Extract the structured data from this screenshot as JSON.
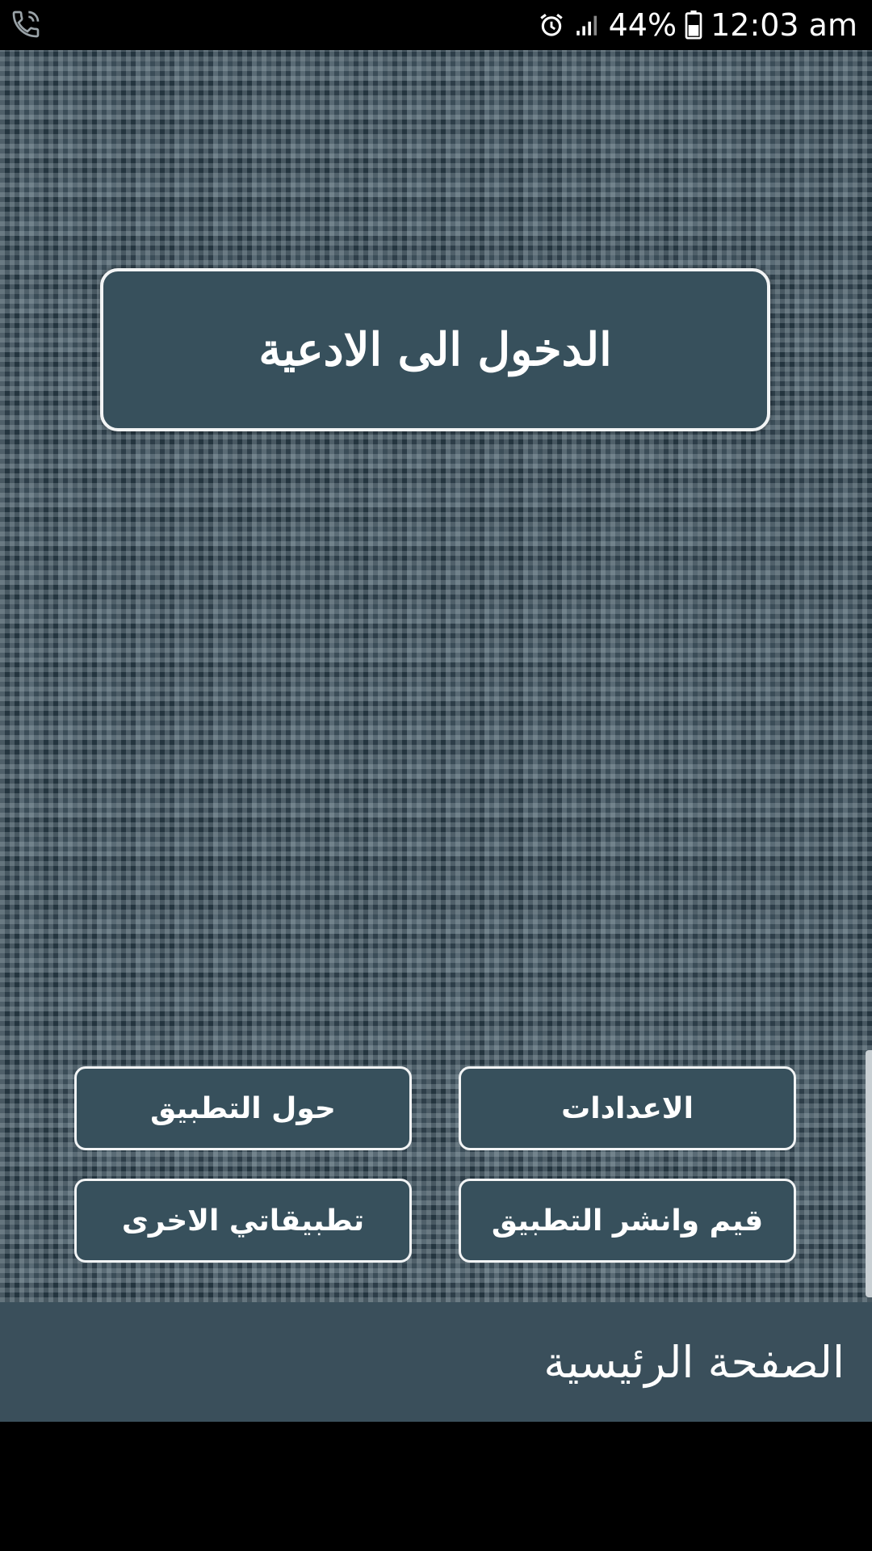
{
  "status_bar": {
    "battery": "44%",
    "time": "12:03 am",
    "icons": [
      "phone-call-icon",
      "alarm-icon",
      "signal-icon",
      "battery-icon"
    ]
  },
  "main": {
    "enter_button_label": "الدخول الى الادعية"
  },
  "menu": {
    "settings_label": "الاعدادات",
    "about_label": "حول التطبيق",
    "rate_share_label": "قيم وانشر التطبيق",
    "my_apps_label": "تطبيقاتي الاخرى"
  },
  "bottom_bar": {
    "title": "الصفحة الرئيسية"
  },
  "colors": {
    "button_bg": "#37505c",
    "bar_bg": "#3a4f5b",
    "border": "#f2f4f5"
  }
}
